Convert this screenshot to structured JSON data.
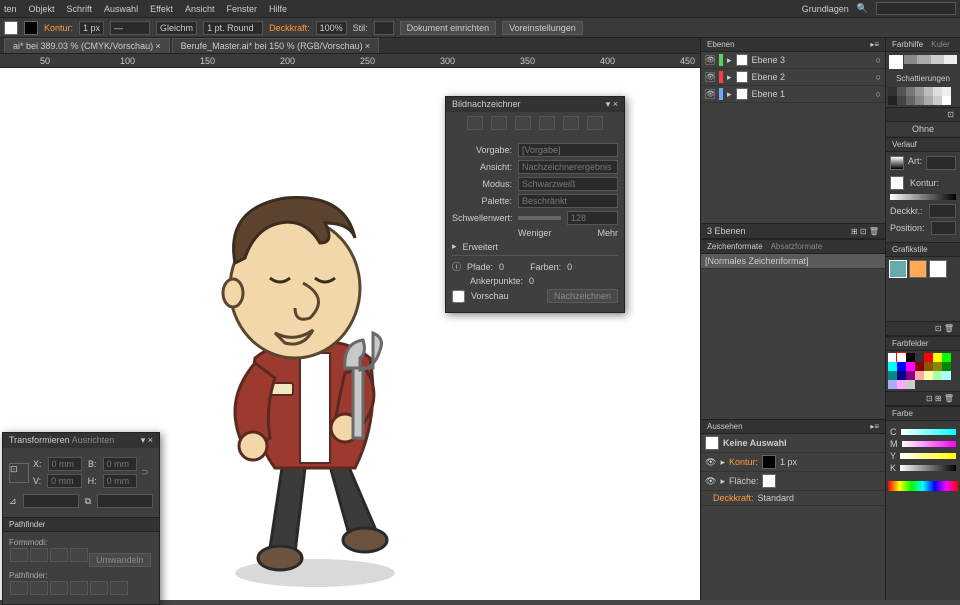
{
  "menu": {
    "items": [
      "ten",
      "Objekt",
      "Schrift",
      "Auswahl",
      "Effekt",
      "Ansicht",
      "Fenster",
      "Hilfe"
    ],
    "workspace": "Grundlagen"
  },
  "optbar": {
    "kontur": "Kontur:",
    "stroke_val": "1 px",
    "align": "Gleichm",
    "brush": "1 pt. Round",
    "deckkraft": "Deckkraft:",
    "opacity": "100%",
    "stil": "Stil:",
    "doc_setup": "Dokument einrichten",
    "prefs": "Voreinstellungen"
  },
  "tabs": {
    "t1": "ai* bei 389.03 % (CMYK/Vorschau)",
    "t2": "Berufe_Master.ai* bei 150 % (RGB/Vorschau)"
  },
  "layers": {
    "title": "Ebenen",
    "items": [
      {
        "n": "Ebene 3",
        "c": "#5bd25b"
      },
      {
        "n": "Ebene 2",
        "c": "#ff3b3b"
      },
      {
        "n": "Ebene 1",
        "c": "#6aa9ff"
      }
    ],
    "footer": "3 Ebenen"
  },
  "charstyles": {
    "tab1": "Zeichenformate",
    "tab2": "Absatzformate",
    "item": "[Normales Zeichenformat]"
  },
  "appearance": {
    "title": "Aussehen",
    "none": "Keine Auswahl",
    "kontur": "Kontur:",
    "kontur_val": "1 px",
    "flaeche": "Fläche:",
    "deck": "Deckkraft:",
    "deck_val": "Standard"
  },
  "trace": {
    "title": "Bildnachzeichner",
    "vorgabe": "Vorgabe:",
    "vorgabe_v": "[Vorgabe]",
    "ansicht": "Ansicht:",
    "ansicht_v": "Nachzeichnerergebnis",
    "modus": "Modus:",
    "modus_v": "Schwarzweiß",
    "palette": "Palette:",
    "palette_v": "Beschränkt",
    "schwelle": "Schwellenwert:",
    "schwelle_v": "128",
    "weniger": "Weniger",
    "mehr": "Mehr",
    "erweitert": "Erweitert",
    "pfade": "Pfade:",
    "pfade_v": "0",
    "farben": "Farben:",
    "farben_v": "0",
    "anker": "Ankerpunkte:",
    "anker_v": "0",
    "vorschau": "Vorschau",
    "nachz": "Nachzeichnen"
  },
  "transform": {
    "tab1": "Transformieren",
    "tab2": "Ausrichten",
    "x": "X:",
    "y": "B:",
    "w": "V:",
    "h": "H:",
    "mm": "0 mm"
  },
  "pathfinder": {
    "title": "Pathfinder",
    "fm": "Formmodi:",
    "umw": "Umwandeln",
    "pf": "Pathfinder:"
  },
  "right": {
    "farbhilfe": "Farbhilfe",
    "kuler": "Kuler",
    "schatt": "Schattierungen",
    "ohne": "Ohne",
    "verlauf": "Verlauf",
    "art": "Art:",
    "kontur": "Kontur:",
    "deckkr": "Deckkr.:",
    "position": "Position:",
    "grafik": "Grafikstile",
    "farbfelder": "Farbfelder",
    "farbe": "Farbe"
  },
  "cmyk": {
    "c": "C",
    "m": "M",
    "y": "Y",
    "k": "K"
  }
}
